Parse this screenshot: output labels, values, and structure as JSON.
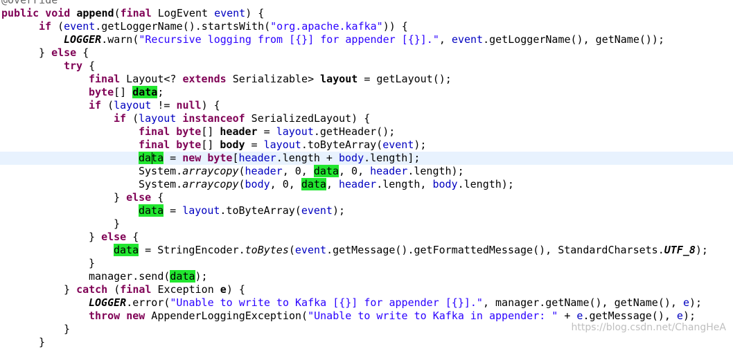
{
  "editor": {
    "lines": [
      {
        "indent": 2,
        "tokens": [
          {
            "c": "an",
            "t": "@Override"
          }
        ]
      },
      {
        "indent": 2,
        "tokens": [
          {
            "c": "k",
            "t": "public"
          },
          {
            "c": "t",
            "t": " "
          },
          {
            "c": "k",
            "t": "void"
          },
          {
            "c": "t",
            "t": " "
          },
          {
            "c": "b",
            "t": "append"
          },
          {
            "c": "t",
            "t": "("
          },
          {
            "c": "k",
            "t": "final"
          },
          {
            "c": "t",
            "t": " LogEvent "
          },
          {
            "c": "v",
            "t": "event"
          },
          {
            "c": "t",
            "t": ") {"
          }
        ]
      },
      {
        "indent": 56,
        "tokens": [
          {
            "c": "k",
            "t": "if"
          },
          {
            "c": "t",
            "t": " ("
          },
          {
            "c": "v",
            "t": "event"
          },
          {
            "c": "t",
            "t": ".getLoggerName().startsWith("
          },
          {
            "c": "s",
            "t": "\"org.apache.kafka\""
          },
          {
            "c": "t",
            "t": ")) {"
          }
        ]
      },
      {
        "indent": 92,
        "tokens": [
          {
            "c": "sf",
            "t": "LOGGER"
          },
          {
            "c": "t",
            "t": ".warn("
          },
          {
            "c": "s",
            "t": "\"Recursive logging from [{}] for appender [{}].\""
          },
          {
            "c": "t",
            "t": ", "
          },
          {
            "c": "v",
            "t": "event"
          },
          {
            "c": "t",
            "t": ".getLoggerName(), getName());"
          }
        ]
      },
      {
        "indent": 56,
        "tokens": [
          {
            "c": "t",
            "t": "} "
          },
          {
            "c": "k",
            "t": "else"
          },
          {
            "c": "t",
            "t": " {"
          }
        ]
      },
      {
        "indent": 92,
        "tokens": [
          {
            "c": "k",
            "t": "try"
          },
          {
            "c": "t",
            "t": " {"
          }
        ]
      },
      {
        "indent": 128,
        "tokens": [
          {
            "c": "k",
            "t": "final"
          },
          {
            "c": "t",
            "t": " Layout<? "
          },
          {
            "c": "k",
            "t": "extends"
          },
          {
            "c": "t",
            "t": " Serializable> "
          },
          {
            "c": "b",
            "t": "layout"
          },
          {
            "c": "t",
            "t": " = getLayout();"
          }
        ]
      },
      {
        "indent": 128,
        "tokens": [
          {
            "c": "k",
            "t": "byte"
          },
          {
            "c": "t",
            "t": "[] "
          },
          {
            "c": "hlb",
            "t": "data"
          },
          {
            "c": "t",
            "t": ";"
          }
        ]
      },
      {
        "indent": 128,
        "tokens": [
          {
            "c": "k",
            "t": "if"
          },
          {
            "c": "t",
            "t": " ("
          },
          {
            "c": "v",
            "t": "layout"
          },
          {
            "c": "t",
            "t": " != "
          },
          {
            "c": "k",
            "t": "null"
          },
          {
            "c": "t",
            "t": ") {"
          }
        ]
      },
      {
        "indent": 164,
        "tokens": [
          {
            "c": "k",
            "t": "if"
          },
          {
            "c": "t",
            "t": " ("
          },
          {
            "c": "v",
            "t": "layout"
          },
          {
            "c": "t",
            "t": " "
          },
          {
            "c": "k",
            "t": "instanceof"
          },
          {
            "c": "t",
            "t": " SerializedLayout) {"
          }
        ]
      },
      {
        "indent": 200,
        "tokens": [
          {
            "c": "k",
            "t": "final"
          },
          {
            "c": "t",
            "t": " "
          },
          {
            "c": "k",
            "t": "byte"
          },
          {
            "c": "t",
            "t": "[] "
          },
          {
            "c": "b",
            "t": "header"
          },
          {
            "c": "t",
            "t": " = "
          },
          {
            "c": "v",
            "t": "layout"
          },
          {
            "c": "t",
            "t": ".getHeader();"
          }
        ]
      },
      {
        "indent": 200,
        "tokens": [
          {
            "c": "k",
            "t": "final"
          },
          {
            "c": "t",
            "t": " "
          },
          {
            "c": "k",
            "t": "byte"
          },
          {
            "c": "t",
            "t": "[] "
          },
          {
            "c": "b",
            "t": "body"
          },
          {
            "c": "t",
            "t": " = "
          },
          {
            "c": "v",
            "t": "layout"
          },
          {
            "c": "t",
            "t": ".toByteArray("
          },
          {
            "c": "v",
            "t": "event"
          },
          {
            "c": "t",
            "t": ");"
          }
        ]
      },
      {
        "indent": 200,
        "current": true,
        "tokens": [
          {
            "c": "hl",
            "t": "data"
          },
          {
            "c": "t",
            "t": " = "
          },
          {
            "c": "k",
            "t": "new"
          },
          {
            "c": "t",
            "t": " "
          },
          {
            "c": "k",
            "t": "byte"
          },
          {
            "c": "t",
            "t": "["
          },
          {
            "c": "v",
            "t": "header"
          },
          {
            "c": "t",
            "t": ".length + "
          },
          {
            "c": "v",
            "t": "body"
          },
          {
            "c": "t",
            "t": ".length];"
          }
        ]
      },
      {
        "indent": 200,
        "tokens": [
          {
            "c": "t",
            "t": "System."
          },
          {
            "c": "ti",
            "t": "arraycopy"
          },
          {
            "c": "t",
            "t": "("
          },
          {
            "c": "v",
            "t": "header"
          },
          {
            "c": "t",
            "t": ", 0, "
          },
          {
            "c": "hl",
            "t": "data"
          },
          {
            "c": "t",
            "t": ", 0, "
          },
          {
            "c": "v",
            "t": "header"
          },
          {
            "c": "t",
            "t": ".length);"
          }
        ]
      },
      {
        "indent": 200,
        "tokens": [
          {
            "c": "t",
            "t": "System."
          },
          {
            "c": "ti",
            "t": "arraycopy"
          },
          {
            "c": "t",
            "t": "("
          },
          {
            "c": "v",
            "t": "body"
          },
          {
            "c": "t",
            "t": ", 0, "
          },
          {
            "c": "hl",
            "t": "data"
          },
          {
            "c": "t",
            "t": ", "
          },
          {
            "c": "v",
            "t": "header"
          },
          {
            "c": "t",
            "t": ".length, "
          },
          {
            "c": "v",
            "t": "body"
          },
          {
            "c": "t",
            "t": ".length);"
          }
        ]
      },
      {
        "indent": 164,
        "tokens": [
          {
            "c": "t",
            "t": "} "
          },
          {
            "c": "k",
            "t": "else"
          },
          {
            "c": "t",
            "t": " {"
          }
        ]
      },
      {
        "indent": 200,
        "tokens": [
          {
            "c": "hl",
            "t": "data"
          },
          {
            "c": "t",
            "t": " = "
          },
          {
            "c": "v",
            "t": "layout"
          },
          {
            "c": "t",
            "t": ".toByteArray("
          },
          {
            "c": "v",
            "t": "event"
          },
          {
            "c": "t",
            "t": ");"
          }
        ]
      },
      {
        "indent": 164,
        "tokens": [
          {
            "c": "t",
            "t": "}"
          }
        ]
      },
      {
        "indent": 128,
        "tokens": [
          {
            "c": "t",
            "t": "} "
          },
          {
            "c": "k",
            "t": "else"
          },
          {
            "c": "t",
            "t": " {"
          }
        ]
      },
      {
        "indent": 164,
        "tokens": [
          {
            "c": "hl",
            "t": "data"
          },
          {
            "c": "t",
            "t": " = StringEncoder."
          },
          {
            "c": "ti",
            "t": "toBytes"
          },
          {
            "c": "t",
            "t": "("
          },
          {
            "c": "v",
            "t": "event"
          },
          {
            "c": "t",
            "t": ".getMessage().getFormattedMessage(), StandardCharsets."
          },
          {
            "c": "sf",
            "t": "UTF_8"
          },
          {
            "c": "t",
            "t": ");"
          }
        ]
      },
      {
        "indent": 128,
        "tokens": [
          {
            "c": "t",
            "t": "}"
          }
        ]
      },
      {
        "indent": 128,
        "tokens": [
          {
            "c": "t",
            "t": "manager.send("
          },
          {
            "c": "hl",
            "t": "data"
          },
          {
            "c": "t",
            "t": ");"
          }
        ]
      },
      {
        "indent": 92,
        "tokens": [
          {
            "c": "t",
            "t": "} "
          },
          {
            "c": "k",
            "t": "catch"
          },
          {
            "c": "t",
            "t": " ("
          },
          {
            "c": "k",
            "t": "final"
          },
          {
            "c": "t",
            "t": " Exception "
          },
          {
            "c": "b",
            "t": "e"
          },
          {
            "c": "t",
            "t": ") {"
          }
        ]
      },
      {
        "indent": 128,
        "tokens": [
          {
            "c": "sf",
            "t": "LOGGER"
          },
          {
            "c": "t",
            "t": ".error("
          },
          {
            "c": "s",
            "t": "\"Unable to write to Kafka [{}] for appender [{}].\""
          },
          {
            "c": "t",
            "t": ", manager.getName(), getName(), "
          },
          {
            "c": "v",
            "t": "e"
          },
          {
            "c": "t",
            "t": ");"
          }
        ]
      },
      {
        "indent": 128,
        "tokens": [
          {
            "c": "k",
            "t": "throw"
          },
          {
            "c": "t",
            "t": " "
          },
          {
            "c": "k",
            "t": "new"
          },
          {
            "c": "t",
            "t": " AppenderLoggingException("
          },
          {
            "c": "s",
            "t": "\"Unable to write to Kafka in appender: \""
          },
          {
            "c": "t",
            "t": " + "
          },
          {
            "c": "v",
            "t": "e"
          },
          {
            "c": "t",
            "t": ".getMessage(), "
          },
          {
            "c": "v",
            "t": "e"
          },
          {
            "c": "t",
            "t": ");"
          }
        ]
      },
      {
        "indent": 92,
        "tokens": [
          {
            "c": "t",
            "t": "}"
          }
        ]
      },
      {
        "indent": 56,
        "tokens": [
          {
            "c": "t",
            "t": "}"
          }
        ]
      }
    ]
  },
  "watermark": "https://blog.csdn.net/ChangHeA"
}
